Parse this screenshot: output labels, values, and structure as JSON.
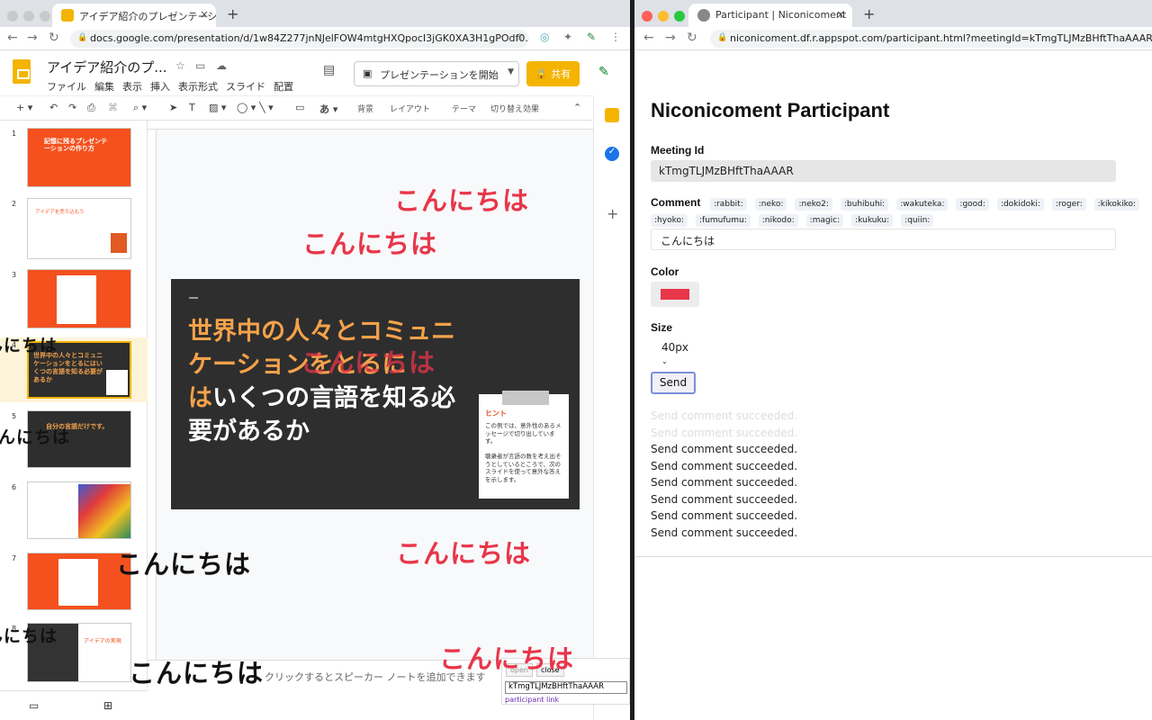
{
  "left_browser": {
    "tab_title": "アイデア紹介のプレゼンテーシ",
    "url": "docs.google.com/presentation/d/1w84Z277jnNJelFOW4mtgHXQpocI3jGK0XA3H1gPOdf0...",
    "slides": {
      "doc_title": "アイデア紹介のプ...",
      "menu": [
        "ファイル",
        "編集",
        "表示",
        "挿入",
        "表示形式",
        "スライド",
        "配置"
      ],
      "present_label": "プレゼンテーションを開始",
      "share_label": "共有",
      "toolbar": {
        "background": "背景",
        "layout": "レイアウト",
        "theme": "テーマ",
        "transition": "切り替え効果"
      },
      "thumbnails": [
        {
          "n": "1",
          "text": "記憶に残るプレゼンテーションの作り方"
        },
        {
          "n": "2",
          "text": "アイデアを売り込もう"
        },
        {
          "n": "3",
          "text": ""
        },
        {
          "n": "4",
          "text": "世界中の人々とコミュニケーションをとるにはいくつの言語を知る必要があるか"
        },
        {
          "n": "5",
          "text": "自分の言語だけです。"
        },
        {
          "n": "6",
          "text": ""
        },
        {
          "n": "7",
          "text": ""
        },
        {
          "n": "8",
          "text": "アイデアの実現"
        }
      ],
      "slide": {
        "heading_orange": "世界中の人々とコミュニケーションをとるに",
        "heading_orange2": "は",
        "heading_white": "いくつの言語を知る必要があるか",
        "card_title": "ヒント",
        "card_body1": "この例では、意外性のあるメッセージで切り出しています。",
        "card_body2": "聴衆者が言語の数を考え出そうとしているところで、次のスライドを使って意外な答えを示します。"
      },
      "notes_placeholder": "クリックするとスピーカー ノートを追加できます",
      "niconico_text": "こんにちは",
      "widget": {
        "open": "open",
        "close": "close",
        "meeting_id": "kTmgTLJMzBHftThaAAAR",
        "link": "participant link"
      }
    }
  },
  "right_browser": {
    "tab_title": "Participant | Niconicoment",
    "url": "niconicoment.df.r.appspot.com/participant.html?meetingId=kTmgTLJMzBHftThaAAAR",
    "title": "Niconicoment Participant",
    "meeting_id_label": "Meeting Id",
    "meeting_id": "kTmgTLJMzBHftThaAAAR",
    "comment_label": "Comment",
    "stamps": [
      ":rabbit:",
      ":neko:",
      ":neko2:",
      ":buhibuhi:",
      ":wakuteka:",
      ":good:",
      ":dokidoki:",
      ":roger:",
      ":kikokiko:",
      ":hyoko:",
      ":fumufumu:",
      ":nikodo:",
      ":magic:",
      ":kukuku:",
      ":quiin:"
    ],
    "comment_value": "こんにちは",
    "color_label": "Color",
    "color_value": "#e8364a",
    "size_label": "Size",
    "size_value": "40px",
    "send_label": "Send",
    "log": [
      "Send comment succeeded.",
      "Send comment succeeded.",
      "Send comment succeeded.",
      "Send comment succeeded.",
      "Send comment succeeded.",
      "Send comment succeeded.",
      "Send comment succeeded.",
      "Send comment succeeded."
    ]
  },
  "colors": {
    "accent_orange": "#f4511e",
    "share_yellow": "#f4b400",
    "comment_red": "#e8364a"
  }
}
